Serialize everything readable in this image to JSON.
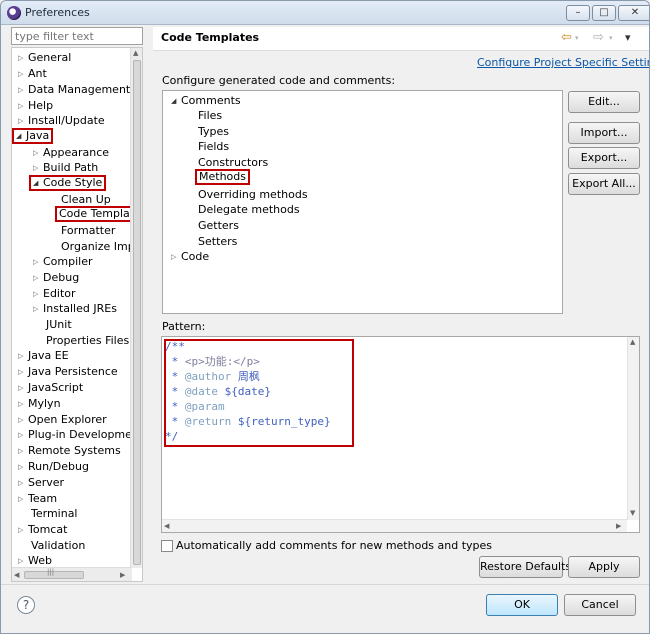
{
  "window": {
    "title": "Preferences",
    "controls": {
      "minimize": "–",
      "maximize": "□",
      "close": "✕"
    }
  },
  "filter": {
    "placeholder": "type filter text"
  },
  "tree": {
    "items": [
      {
        "label": "General",
        "expander": "▷"
      },
      {
        "label": "Ant",
        "expander": "▷"
      },
      {
        "label": "Data Management",
        "expander": "▷"
      },
      {
        "label": "Help",
        "expander": "▷"
      },
      {
        "label": "Install/Update",
        "expander": "▷"
      },
      {
        "label": "Java",
        "expander": "◢"
      },
      {
        "label": "Appearance",
        "expander": "▷"
      },
      {
        "label": "Build Path",
        "expander": "▷"
      },
      {
        "label": "Code Style",
        "expander": "◢"
      },
      {
        "label": "Clean Up",
        "expander": ""
      },
      {
        "label": "Code Template",
        "expander": ""
      },
      {
        "label": "Formatter",
        "expander": ""
      },
      {
        "label": "Organize Impo",
        "expander": ""
      },
      {
        "label": "Compiler",
        "expander": "▷"
      },
      {
        "label": "Debug",
        "expander": "▷"
      },
      {
        "label": "Editor",
        "expander": "▷"
      },
      {
        "label": "Installed JREs",
        "expander": "▷"
      },
      {
        "label": "JUnit",
        "expander": ""
      },
      {
        "label": "Properties Files Ed",
        "expander": ""
      },
      {
        "label": "Java EE",
        "expander": "▷"
      },
      {
        "label": "Java Persistence",
        "expander": "▷"
      },
      {
        "label": "JavaScript",
        "expander": "▷"
      },
      {
        "label": "Mylyn",
        "expander": "▷"
      },
      {
        "label": "Open Explorer",
        "expander": "▷"
      },
      {
        "label": "Plug-in Development",
        "expander": "▷"
      },
      {
        "label": "Remote Systems",
        "expander": "▷"
      },
      {
        "label": "Run/Debug",
        "expander": "▷"
      },
      {
        "label": "Server",
        "expander": "▷"
      },
      {
        "label": "Team",
        "expander": "▷"
      },
      {
        "label": "Terminal",
        "expander": ""
      },
      {
        "label": "Tomcat",
        "expander": "▷"
      },
      {
        "label": "Validation",
        "expander": ""
      },
      {
        "label": "Web",
        "expander": "▷"
      }
    ]
  },
  "panel": {
    "title": "Code Templates",
    "project_link": "Configure Project Specific Settings...",
    "configure_label": "Configure generated code and comments:",
    "pattern_label": "Pattern:"
  },
  "templates": {
    "comments": {
      "label": "Comments",
      "expander": "◢"
    },
    "children": [
      "Files",
      "Types",
      "Fields",
      "Constructors",
      "Methods",
      "Overriding methods",
      "Delegate methods",
      "Getters",
      "Setters"
    ],
    "code": {
      "label": "Code",
      "expander": "▷"
    }
  },
  "side_buttons": {
    "edit": "Edit...",
    "import": "Import...",
    "export": "Export...",
    "export_all": "Export All..."
  },
  "pattern_lines": {
    "l1": "/**",
    "l2_star": " * ",
    "l2_text": "<p>功能:</p>",
    "l3_star": " * ",
    "l3_tag": "@author",
    "l3_text": " 周枫",
    "l4_star": " * ",
    "l4_tag": "@date",
    "l4_text": " ${date}",
    "l5_star": " * ",
    "l5_tag": "@param",
    "l6_star": " * ",
    "l6_tag": "@return",
    "l6_text": " ${return_type}",
    "l7": "*/"
  },
  "auto_comments_label": "Automatically add comments for new methods and types",
  "buttons": {
    "restore_defaults": "Restore Defaults",
    "apply": "Apply",
    "ok": "OK",
    "cancel": "Cancel"
  },
  "icons": {
    "help": "?",
    "back": "⇦",
    "forward": "⇨",
    "menu": "▾"
  },
  "scroll": {
    "up": "▲",
    "down": "▼",
    "left": "◀",
    "right": "▶",
    "grip": "|||",
    "corner_up": "▲",
    "corner_down": "▼"
  },
  "colors": {
    "highlight_border": "#c00000",
    "link": "#0b56a8",
    "javadoc": "#3f5fbf"
  }
}
